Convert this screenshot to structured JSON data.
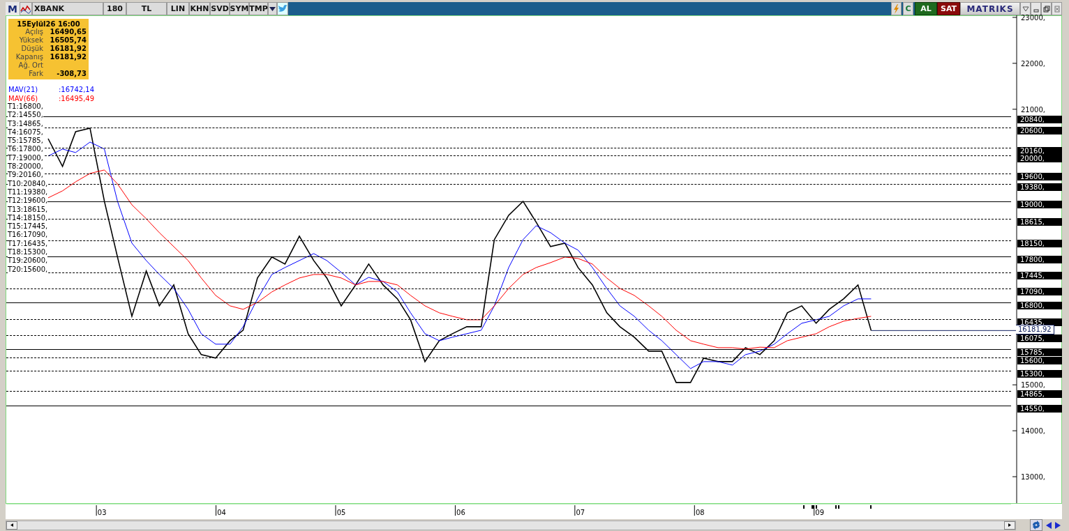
{
  "toolbar": {
    "logo": "M",
    "symbol": "XBANK",
    "period": "180",
    "currency": "TL",
    "buttons": [
      "LIN",
      "KHN",
      "SVD",
      "SYM",
      "TMP"
    ],
    "refresh_label": "C",
    "buy": "AL",
    "sell": "SAT",
    "brand": "MATRIKS"
  },
  "info_box": {
    "date": "15Eylül26 16:00",
    "rows": [
      {
        "label": "Açılış",
        "value": "16490,65"
      },
      {
        "label": "Yüksek",
        "value": "16505,74"
      },
      {
        "label": "Düşük",
        "value": "16181,92"
      },
      {
        "label": "Kapanış",
        "value": "16181,92"
      },
      {
        "label": "Ağ. Ort"
      },
      {
        "label": "Fark",
        "value": "-308,73"
      }
    ]
  },
  "indicator_values": [
    ":16742,14",
    ":16495,49"
  ],
  "level_legend": [
    "T1:16800,",
    "T2:14550,",
    "T3:14865,",
    "T4:16075,",
    "T5:15785,",
    "T6:17800,",
    "T7:19000,",
    "T8:20000,",
    "T9:20160,",
    "T10:20840,",
    "T11:19380,",
    "T12:19600,",
    "T13:18615,",
    "T14:18150,",
    "T15:17445,",
    "T16:17090,",
    "T17:16435,",
    "T18:15300,",
    "T19:20600,",
    "T20:15600,"
  ],
  "levels": [
    {
      "axis_label": "20840,",
      "dashed": false
    },
    {
      "axis_label": "20600,",
      "dashed": true
    },
    {
      "axis_label": "20160,",
      "dashed": true
    },
    {
      "axis_label": "20000,",
      "dashed": true
    },
    {
      "axis_label": "19600,",
      "dashed": true
    },
    {
      "axis_label": "19380,",
      "dashed": true
    },
    {
      "axis_label": "19000,",
      "dashed": false
    },
    {
      "axis_label": "18615,",
      "dashed": true
    },
    {
      "axis_label": "18150,",
      "dashed": true
    },
    {
      "axis_label": "17800,",
      "dashed": false
    },
    {
      "axis_label": "17445,",
      "dashed": true
    },
    {
      "axis_label": "17090,",
      "dashed": true
    },
    {
      "axis_label": "16800,",
      "dashed": false
    },
    {
      "axis_label": "16435,",
      "dashed": true
    },
    {
      "axis_label": "16075,",
      "dashed": true
    },
    {
      "axis_label": "15785,",
      "dashed": false
    },
    {
      "axis_label": "15600,",
      "dashed": true
    },
    {
      "axis_label": "15300,",
      "dashed": true
    },
    {
      "axis_label": "14865,",
      "dashed": true
    },
    {
      "axis_label": "14550,",
      "dashed": false
    }
  ],
  "last_price": "16181,92",
  "chart_data": {
    "type": "line",
    "x": [
      2.55,
      2.67,
      2.78,
      2.9,
      3.02,
      3.13,
      3.25,
      3.37,
      3.48,
      3.6,
      3.72,
      3.83,
      3.95,
      4.07,
      4.18,
      4.3,
      4.42,
      4.53,
      4.65,
      4.77,
      4.88,
      5.0,
      5.12,
      5.23,
      5.35,
      5.47,
      5.58,
      5.7,
      5.82,
      5.93,
      6.05,
      6.17,
      6.28,
      6.4,
      6.52,
      6.63,
      6.75,
      6.87,
      6.98,
      7.1,
      7.22,
      7.33,
      7.45,
      7.57,
      7.68,
      7.8,
      7.92,
      8.03,
      8.15,
      8.27,
      8.38,
      8.5,
      8.62,
      8.73,
      8.85,
      8.97,
      9.08,
      9.2,
      9.32,
      9.43
    ],
    "xlim": [
      2.2,
      10.6
    ],
    "ylim": [
      12470,
      23060
    ],
    "xticks": [
      {
        "value": 3,
        "label": "03"
      },
      {
        "value": 4,
        "label": "04"
      },
      {
        "value": 5,
        "label": "05"
      },
      {
        "value": 6,
        "label": "06"
      },
      {
        "value": 7,
        "label": "07"
      },
      {
        "value": 8,
        "label": "08"
      },
      {
        "value": 9,
        "label": "09"
      }
    ],
    "yticks": [
      {
        "value": 23000,
        "label": "23000,"
      },
      {
        "value": 22000,
        "label": "22000,"
      },
      {
        "value": 21000,
        "label": "21000,"
      },
      {
        "value": 15000,
        "label": "15000,"
      },
      {
        "value": 14000,
        "label": "14000,"
      },
      {
        "value": 13000,
        "label": "13000,"
      }
    ],
    "series": [
      {
        "color": "#000000",
        "values": [
          20360,
          19754,
          20512,
          20588,
          18995,
          17782,
          16492,
          17478,
          16720,
          17175,
          16113,
          15658,
          15582,
          15961,
          16189,
          17326,
          17782,
          17630,
          18237,
          17706,
          17326,
          16720,
          17175,
          17630,
          17175,
          16871,
          16416,
          15506,
          15961,
          16113,
          16265,
          16265,
          18161,
          18692,
          18995,
          18540,
          18009,
          18085,
          17554,
          17175,
          16568,
          16265,
          16037,
          15734,
          15734,
          15051,
          15051,
          15582,
          15506,
          15506,
          15809,
          15658,
          15961,
          16568,
          16720,
          16340,
          16644,
          16871,
          17175,
          16182
        ]
      },
      {
        "name": "MAV(21)",
        "color": "#0000ff",
        "values": [
          19981,
          20133,
          20057,
          20285,
          20133,
          18995,
          18085,
          17706,
          17402,
          17099,
          16644,
          16113,
          15885,
          15885,
          16265,
          16871,
          17402,
          17554,
          17706,
          17857,
          17706,
          17450,
          17175,
          17340,
          17251,
          17023,
          16568,
          16113,
          15961,
          16037,
          16113,
          16189,
          16720,
          17554,
          18161,
          18464,
          18312,
          18085,
          17933,
          17554,
          17099,
          16720,
          16492,
          16189,
          15961,
          15658,
          15354,
          15506,
          15506,
          15430,
          15658,
          15734,
          15885,
          16113,
          16340,
          16416,
          16492,
          16720,
          16871,
          16871
        ]
      },
      {
        "name": "MAV(66)",
        "color": "#ff0000",
        "values": [
          19071,
          19223,
          19420,
          19602,
          19678,
          19374,
          18919,
          18616,
          18312,
          18009,
          17706,
          17326,
          16947,
          16720,
          16644,
          16795,
          17023,
          17175,
          17326,
          17402,
          17402,
          17326,
          17175,
          17251,
          17251,
          17175,
          16947,
          16720,
          16568,
          16492,
          16416,
          16416,
          16720,
          17099,
          17402,
          17554,
          17660,
          17782,
          17751,
          17630,
          17326,
          17099,
          16947,
          16720,
          16492,
          16189,
          15961,
          15885,
          15809,
          15809,
          15779,
          15820,
          15809,
          15961,
          16037,
          16113,
          16265,
          16386,
          16447,
          16492
        ]
      }
    ]
  }
}
